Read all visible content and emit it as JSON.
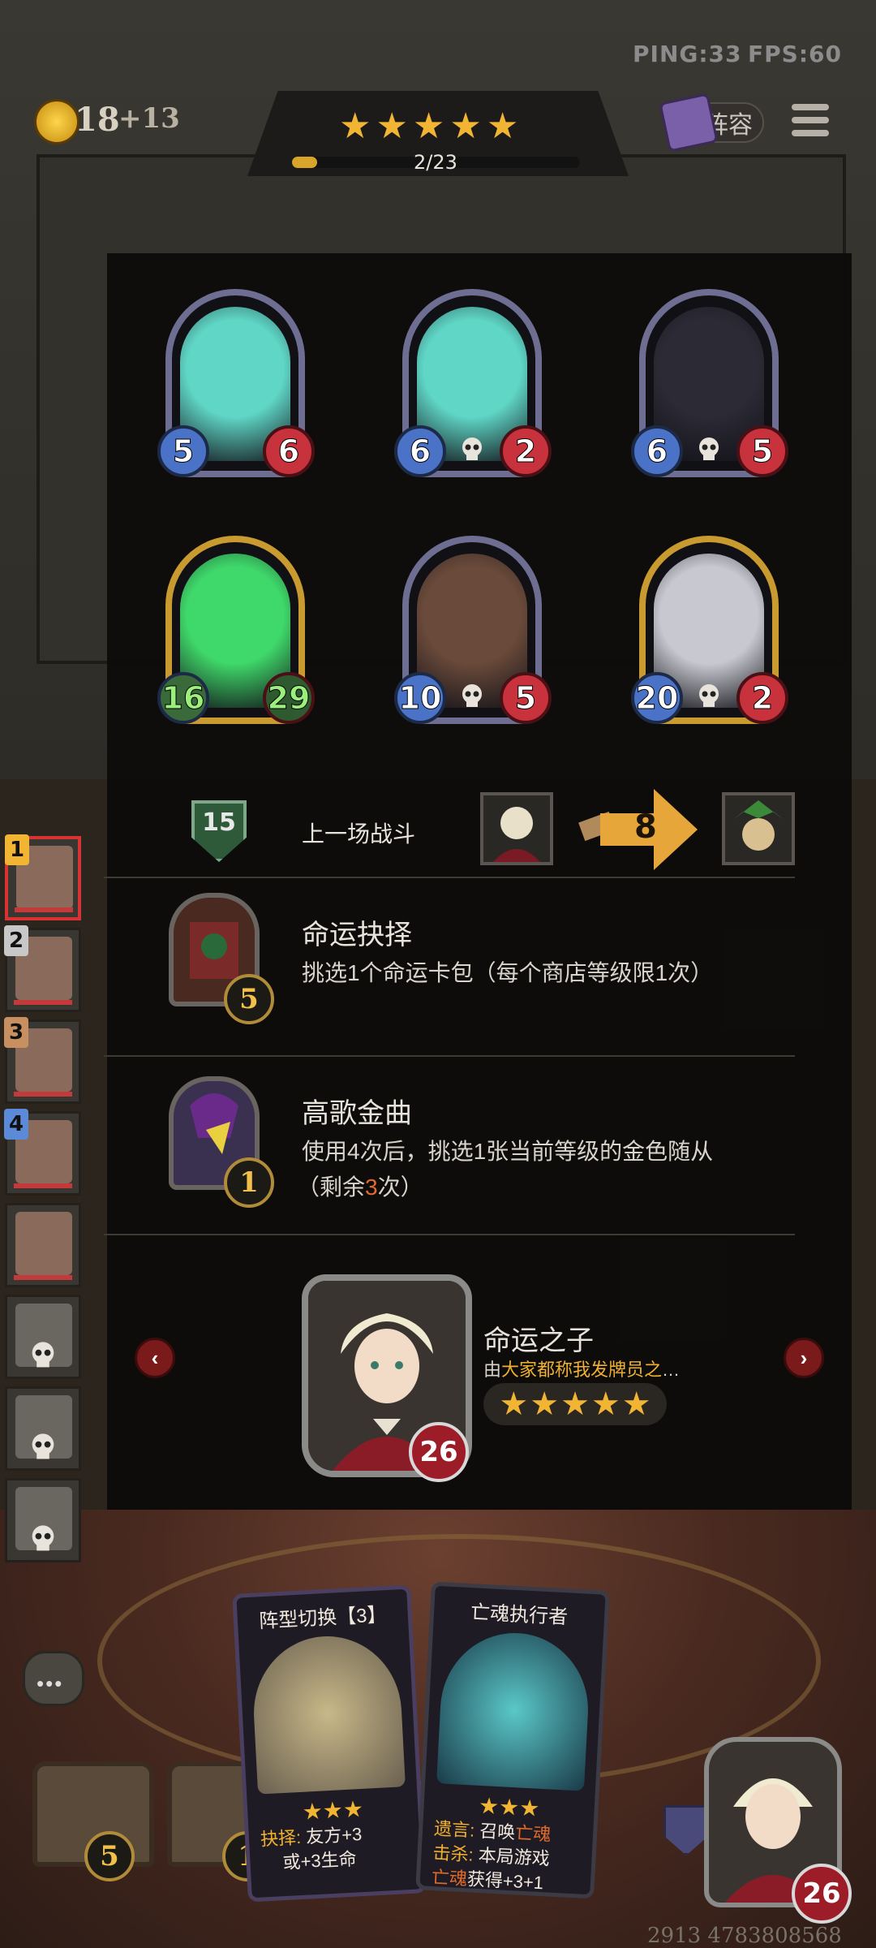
{
  "hud": {
    "ping": "PING:33",
    "fps": "FPS:60",
    "gold": "18",
    "gold_income": "+13",
    "lineup_label": "阵容"
  },
  "tavern": {
    "stars": 5,
    "progress_text": "2/23",
    "progress": 0.087
  },
  "units": [
    {
      "attack": "5",
      "health": "6",
      "golden": false,
      "tint": "#5fd6c6",
      "type": "buff"
    },
    {
      "attack": "6",
      "health": "2",
      "golden": false,
      "tint": "#5fd6c6",
      "type": "skull"
    },
    {
      "attack": "6",
      "health": "5",
      "golden": false,
      "tint": "#2b2a35",
      "type": "skull"
    },
    {
      "attack": "16",
      "health": "29",
      "golden": true,
      "tint": "#3fd86a",
      "type": "buff"
    },
    {
      "attack": "10",
      "health": "5",
      "golden": false,
      "tint": "#6a4a3a",
      "type": "skull"
    },
    {
      "attack": "20",
      "health": "2",
      "golden": true,
      "tint": "#c8c8d0",
      "type": "skull"
    }
  ],
  "last_battle": {
    "rank": "15",
    "label": "上一场战斗",
    "damage": "8"
  },
  "abilities": [
    {
      "title": "命运抉择",
      "desc": "挑选1个命运卡包（每个商店等级限1次）",
      "cost": "5"
    },
    {
      "title": "高歌金曲",
      "desc_line1": "使用4次后，挑选1张当前等级的金色随从",
      "desc_pre": "（剩余",
      "desc_hl": "3",
      "desc_post": "次）",
      "cost": "1"
    }
  ],
  "hero": {
    "name": "命运之子",
    "desc_pre": "由",
    "desc_hl": "大家都称我发牌员之",
    "desc_post": "…",
    "stars": 5,
    "health": "26",
    "prev_icon": "chevron-left-icon",
    "next_icon": "chevron-right-icon"
  },
  "sidebar": [
    {
      "rank": "1",
      "rank_color": "#f2b533",
      "active": true,
      "dead": false
    },
    {
      "rank": "2",
      "rank_color": "#c8c8c8",
      "active": false,
      "dead": false
    },
    {
      "rank": "3",
      "rank_color": "#c89060",
      "active": false,
      "dead": false
    },
    {
      "rank": "4",
      "rank_color": "#5a8ad8",
      "active": false,
      "dead": false
    },
    {
      "rank": "",
      "active": false,
      "dead": false
    },
    {
      "rank": "",
      "active": false,
      "dead": true
    },
    {
      "rank": "",
      "active": false,
      "dead": true
    },
    {
      "rank": "",
      "active": false,
      "dead": true
    }
  ],
  "hand": [
    {
      "title": "阵型切换【3】",
      "stars": 3,
      "line1_key": "抉择:",
      "line1_val": "友方+3",
      "line2": "或+3生命"
    },
    {
      "title": "亡魂执行者",
      "stars": 3,
      "line1_key": "遗言:",
      "line1_val": "召唤",
      "line1_hl": "亡魂",
      "line2_key": "击杀:",
      "line2_val": "本局游戏",
      "line3_hl": "亡魂",
      "line3_val": "获得+3+1"
    }
  ],
  "chests": [
    {
      "count": "5"
    },
    {
      "count": "1"
    }
  ],
  "player": {
    "health": "26"
  },
  "footer_id": "2913 4783808568"
}
